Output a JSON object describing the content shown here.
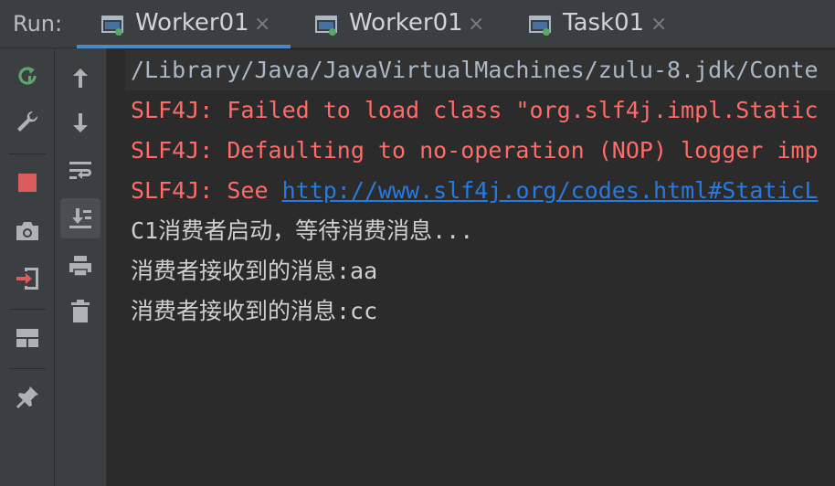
{
  "titlebar": {
    "run_label": "Run:",
    "tabs": [
      {
        "label": "Worker01",
        "close": "×",
        "active": true
      },
      {
        "label": "Worker01",
        "close": "×",
        "active": false
      },
      {
        "label": "Task01",
        "close": "×",
        "active": false
      }
    ]
  },
  "toolbar_left": [
    {
      "icon": "rerun-icon"
    },
    {
      "icon": "wrench-icon"
    },
    {
      "icon": "stop-icon"
    },
    {
      "icon": "camera-icon"
    },
    {
      "icon": "login-icon"
    },
    {
      "icon": "layout-icon"
    },
    {
      "icon": "pin-icon"
    }
  ],
  "toolbar_right": [
    {
      "icon": "arrow-up-icon"
    },
    {
      "icon": "arrow-down-icon"
    },
    {
      "icon": "soft-wrap-icon"
    },
    {
      "icon": "scroll-to-end-icon"
    },
    {
      "icon": "print-icon"
    },
    {
      "icon": "trash-icon"
    }
  ],
  "console": {
    "lines": [
      {
        "kind": "path",
        "text": "/Library/Java/JavaVirtualMachines/zulu-8.jdk/Conte"
      },
      {
        "kind": "err",
        "text": "SLF4J: Failed to load class \"org.slf4j.impl.Static"
      },
      {
        "kind": "err",
        "text": "SLF4J: Defaulting to no-operation (NOP) logger imp"
      },
      {
        "kind": "err-link",
        "prefix": "SLF4J: See ",
        "link": "http://www.slf4j.org/codes.html#StaticL"
      },
      {
        "kind": "out",
        "text": "C1消费者启动，等待消费消息..."
      },
      {
        "kind": "out",
        "text": "消费者接收到的消息:aa"
      },
      {
        "kind": "out",
        "text": "消费者接收到的消息:cc"
      }
    ]
  },
  "colors": {
    "error": "#ff6b68",
    "link": "#287bde",
    "output": "#cfcfcf",
    "tab_underline": "#4a88c7"
  }
}
